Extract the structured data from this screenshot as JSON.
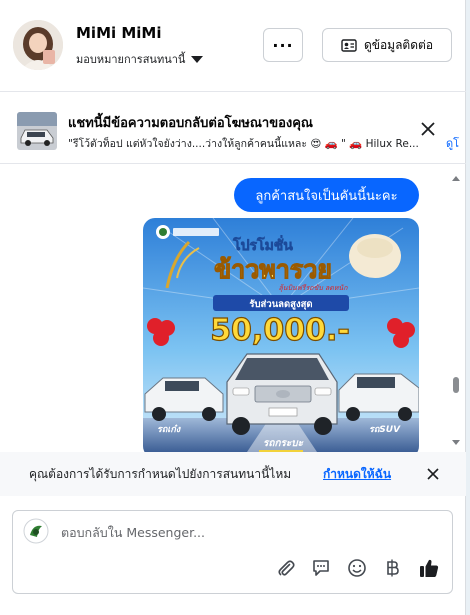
{
  "header": {
    "name": "MiMi MiMi",
    "assign_label": "มอบหมายการสนทนานี้",
    "more_label": "···",
    "contact_label": "ดูข้อมูลติดต่อ"
  },
  "ad_reply": {
    "title": "แชทนี้มีข้อความตอบกลับต่อโฆษณาของคุณ",
    "snippet": "\"รีโว้ตัวท็อป แต่หัวใจยังว่าง....ว่างให้ลูกค้าคนนี้แหละ 😍 🚗 \" 🚗 Hilux Re...",
    "link_text": "ดูโ"
  },
  "messages": {
    "outgoing_text": "ลูกค้าสนใจเป็นคันนี้นะคะ",
    "promo": {
      "headline": "โปรโมชั่น",
      "main": "ข้าวพารวย",
      "tagline": "ลุ้นบินฟรีรถขับ ลดหนัก",
      "discount_label": "รับส่วนลดสูงสุด",
      "amount": "50,000.-",
      "label_left": "รถเก๋ง",
      "label_center": "รถกระบะ",
      "label_right": "รถSUV"
    }
  },
  "schedule_notice": {
    "text": "คุณต้องการได้รับการกำหนดไปยังการสนทนานี้ไหม",
    "link": "กำหนดให้ฉัน"
  },
  "composer": {
    "placeholder": "ตอบกลับใน Messenger..."
  },
  "colors": {
    "accent": "#0866ff",
    "bubble_text": "#ffffff",
    "notice_bg": "#f7f8fa"
  }
}
